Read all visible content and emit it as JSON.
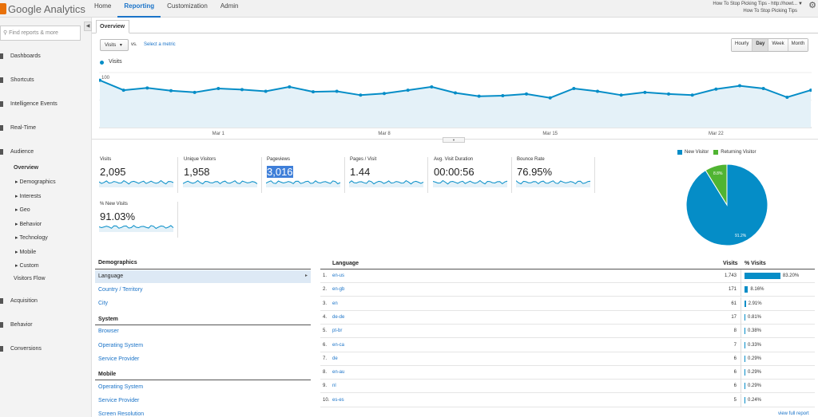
{
  "app": {
    "name": "Google Analytics"
  },
  "topnav": [
    "Home",
    "Reporting",
    "Customization",
    "Admin"
  ],
  "account": {
    "line1": "How To Stop Picking Tips - http://howt...",
    "line2": "How To Stop Picking Tips"
  },
  "sidebar": {
    "search_placeholder": "Find reports & more",
    "sections": {
      "dashboards": "Dashboards",
      "shortcuts": "Shortcuts",
      "intelligence": "Intelligence Events",
      "realtime": "Real-Time",
      "audience": "Audience",
      "acquisition": "Acquisition",
      "behavior": "Behavior",
      "conversions": "Conversions"
    },
    "audience_items": [
      "Overview",
      "Demographics",
      "Interests",
      "Geo",
      "Behavior",
      "Technology",
      "Mobile",
      "Custom"
    ],
    "visitors_flow": "Visitors Flow"
  },
  "tab": "Overview",
  "controls": {
    "metric": "Visits",
    "vs": "vs.",
    "select_metric": "Select a metric",
    "granularity": [
      "Hourly",
      "Day",
      "Week",
      "Month"
    ],
    "selected_granularity": "Day"
  },
  "chart_data": {
    "type": "line",
    "series": [
      {
        "name": "Visits",
        "values": [
          86,
          68,
          72,
          67,
          64,
          71,
          69,
          66,
          74,
          65,
          66,
          59,
          62,
          68,
          74,
          63,
          57,
          58,
          61,
          54,
          71,
          66,
          59,
          64,
          61,
          59,
          70,
          76,
          71,
          55,
          68
        ]
      }
    ],
    "y_ticks": [
      "100",
      "50"
    ],
    "ylim": [
      0,
      100
    ],
    "x_labels": [
      "Mar 1",
      "Mar 8",
      "Mar 15",
      "Mar 22"
    ],
    "x_label_index": [
      5,
      12,
      19,
      26
    ],
    "color": "#058dc7",
    "fill": "#e4f1f8",
    "grid": true
  },
  "metrics": [
    {
      "label": "Visits",
      "value": "2,095",
      "highlight": false
    },
    {
      "label": "Unique Visitors",
      "value": "1,958",
      "highlight": false
    },
    {
      "label": "Pageviews",
      "value": "3,016",
      "highlight": true
    },
    {
      "label": "Pages / Visit",
      "value": "1.44",
      "highlight": false
    },
    {
      "label": "Avg. Visit Duration",
      "value": "00:00:56",
      "highlight": false
    },
    {
      "label": "Bounce Rate",
      "value": "76.95%",
      "highlight": false
    },
    {
      "label": "% New Visits",
      "value": "91.03%",
      "highlight": false
    }
  ],
  "pie": {
    "legend": [
      {
        "name": "New Visitor",
        "color": "#058dc7"
      },
      {
        "name": "Returning Visitor",
        "color": "#50b432"
      }
    ],
    "new_pct": 91.2,
    "new_label": "91.2%",
    "returning_label": "8.8%"
  },
  "demographics": {
    "title": "Demographics",
    "active": "Language",
    "demo_links": [
      "Country / Territory",
      "City"
    ],
    "system_title": "System",
    "system_links": [
      "Browser",
      "Operating System",
      "Service Provider"
    ],
    "mobile_title": "Mobile",
    "mobile_links": [
      "Operating System",
      "Service Provider",
      "Screen Resolution"
    ]
  },
  "table": {
    "headers": {
      "language": "Language",
      "visits": "Visits",
      "pct": "% Visits"
    },
    "rows": [
      {
        "num": "1.",
        "lang": "en-us",
        "visits": "1,743",
        "pct": "83.20%",
        "p": 83.2
      },
      {
        "num": "2.",
        "lang": "en-gb",
        "visits": "171",
        "pct": "8.16%",
        "p": 8.16
      },
      {
        "num": "3.",
        "lang": "en",
        "visits": "61",
        "pct": "2.91%",
        "p": 2.91
      },
      {
        "num": "4.",
        "lang": "de-de",
        "visits": "17",
        "pct": "0.81%",
        "p": 0.81
      },
      {
        "num": "5.",
        "lang": "pt-br",
        "visits": "8",
        "pct": "0.38%",
        "p": 0.38
      },
      {
        "num": "6.",
        "lang": "en-ca",
        "visits": "7",
        "pct": "0.33%",
        "p": 0.33
      },
      {
        "num": "7.",
        "lang": "de",
        "visits": "6",
        "pct": "0.29%",
        "p": 0.29
      },
      {
        "num": "8.",
        "lang": "en-au",
        "visits": "6",
        "pct": "0.29%",
        "p": 0.29
      },
      {
        "num": "9.",
        "lang": "nl",
        "visits": "6",
        "pct": "0.29%",
        "p": 0.29
      },
      {
        "num": "10.",
        "lang": "es-es",
        "visits": "5",
        "pct": "0.24%",
        "p": 0.24
      }
    ],
    "full_report": "view full report"
  }
}
